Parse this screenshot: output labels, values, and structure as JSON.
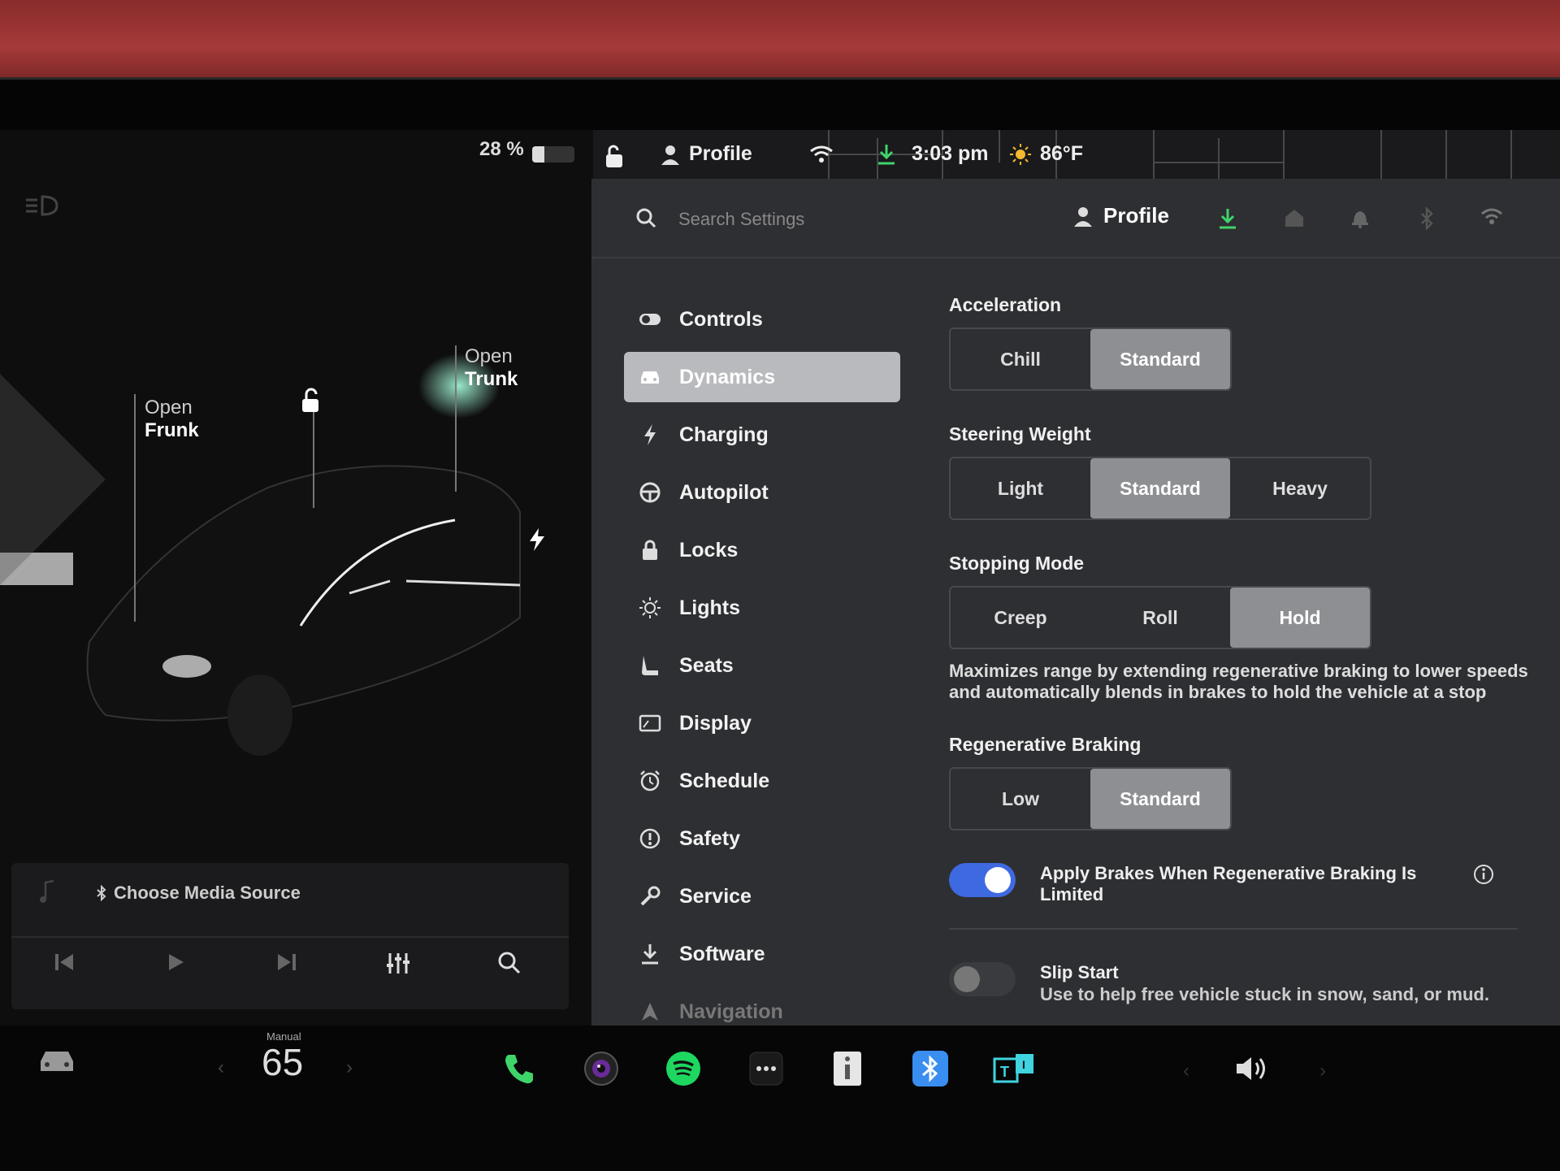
{
  "status": {
    "battery_percent": "28 %",
    "battery_level": 0.28,
    "profile_label": "Profile",
    "time": "3:03 pm",
    "temperature": "86°F"
  },
  "car": {
    "frunk": {
      "line1": "Open",
      "line2": "Frunk"
    },
    "trunk": {
      "line1": "Open",
      "line2": "Trunk"
    }
  },
  "settings": {
    "search_placeholder": "Search Settings",
    "header_profile": "Profile",
    "nav": [
      {
        "label": "Controls",
        "icon": "toggle-icon"
      },
      {
        "label": "Dynamics",
        "icon": "car-icon",
        "active": true
      },
      {
        "label": "Charging",
        "icon": "bolt-icon"
      },
      {
        "label": "Autopilot",
        "icon": "steering-wheel-icon"
      },
      {
        "label": "Locks",
        "icon": "lock-icon"
      },
      {
        "label": "Lights",
        "icon": "sun-icon"
      },
      {
        "label": "Seats",
        "icon": "seat-icon"
      },
      {
        "label": "Display",
        "icon": "display-icon"
      },
      {
        "label": "Schedule",
        "icon": "alarm-clock-icon"
      },
      {
        "label": "Safety",
        "icon": "exclamation-circle-icon"
      },
      {
        "label": "Service",
        "icon": "wrench-icon"
      },
      {
        "label": "Software",
        "icon": "download-icon"
      },
      {
        "label": "Navigation",
        "icon": "navigation-arrow-icon"
      }
    ],
    "acceleration": {
      "title": "Acceleration",
      "options": [
        "Chill",
        "Standard"
      ],
      "selected": "Standard"
    },
    "steering": {
      "title": "Steering Weight",
      "options": [
        "Light",
        "Standard",
        "Heavy"
      ],
      "selected": "Standard"
    },
    "stopping": {
      "title": "Stopping Mode",
      "options": [
        "Creep",
        "Roll",
        "Hold"
      ],
      "selected": "Hold",
      "description": "Maximizes range by extending regenerative braking to lower speeds and automatically blends in brakes to hold the vehicle at a stop"
    },
    "regen": {
      "title": "Regenerative Braking",
      "options": [
        "Low",
        "Standard"
      ],
      "selected": "Standard"
    },
    "apply_brakes": {
      "label": "Apply Brakes When Regenerative Braking Is Limited",
      "on": true
    },
    "slip_start": {
      "label": "Slip Start",
      "sub": "Use to help free vehicle stuck in snow, sand, or mud.",
      "on": false
    }
  },
  "media": {
    "source_label": "Choose Media Source"
  },
  "dock": {
    "speed_mode": "Manual",
    "speed": "65"
  },
  "colors": {
    "accent_blue": "#3e6ae1",
    "download_green": "#3fd46a",
    "panel_bg": "#2e2f32"
  }
}
